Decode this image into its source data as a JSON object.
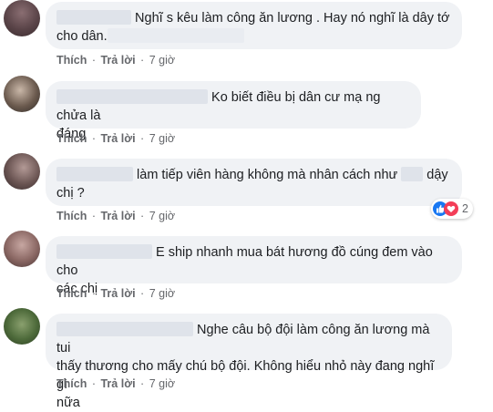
{
  "comments": [
    {
      "text_a": "Nghĩ s kêu làm công ăn lương . Hay nó nghĩ là dây tớ",
      "text_b": "cho dân.",
      "like": "Thích",
      "reply": "Trả lời",
      "time": "7 giờ"
    },
    {
      "text_a": "Ko biết điều bị dân cư mạ ng chửa là",
      "text_b": "đáng",
      "like": "Thích",
      "reply": "Trả lời",
      "time": "7 giờ"
    },
    {
      "text_a": "làm tiếp viên hàng không mà nhân cách như",
      "text_a2": "dậy",
      "text_b": "chị ?",
      "like": "Thích",
      "reply": "Trả lời",
      "time": "7 giờ"
    },
    {
      "text_a": "E ship nhanh mua bát hương đồ cúng đem vào cho",
      "text_b": "các chị",
      "like": "Thích",
      "reply": "Trả lời",
      "time": "7 giờ"
    },
    {
      "text_a": "Nghe câu bộ đội làm công ăn lương mà tui",
      "text_b": "thấy thương cho mấy chú bộ đội. Không hiểu nhỏ này đang nghĩ gì",
      "text_c": "nữa",
      "like": "Thích",
      "reply": "Trả lời",
      "time": "7 giờ"
    }
  ],
  "reaction": {
    "count": "2",
    "icons": [
      "like-icon",
      "heart-icon"
    ]
  },
  "separator": "·",
  "colors": {
    "bubble": "#f0f2f5",
    "meta": "#65676b",
    "text": "#1c1e21",
    "like": "#1877f2",
    "heart": "#f33e58"
  }
}
